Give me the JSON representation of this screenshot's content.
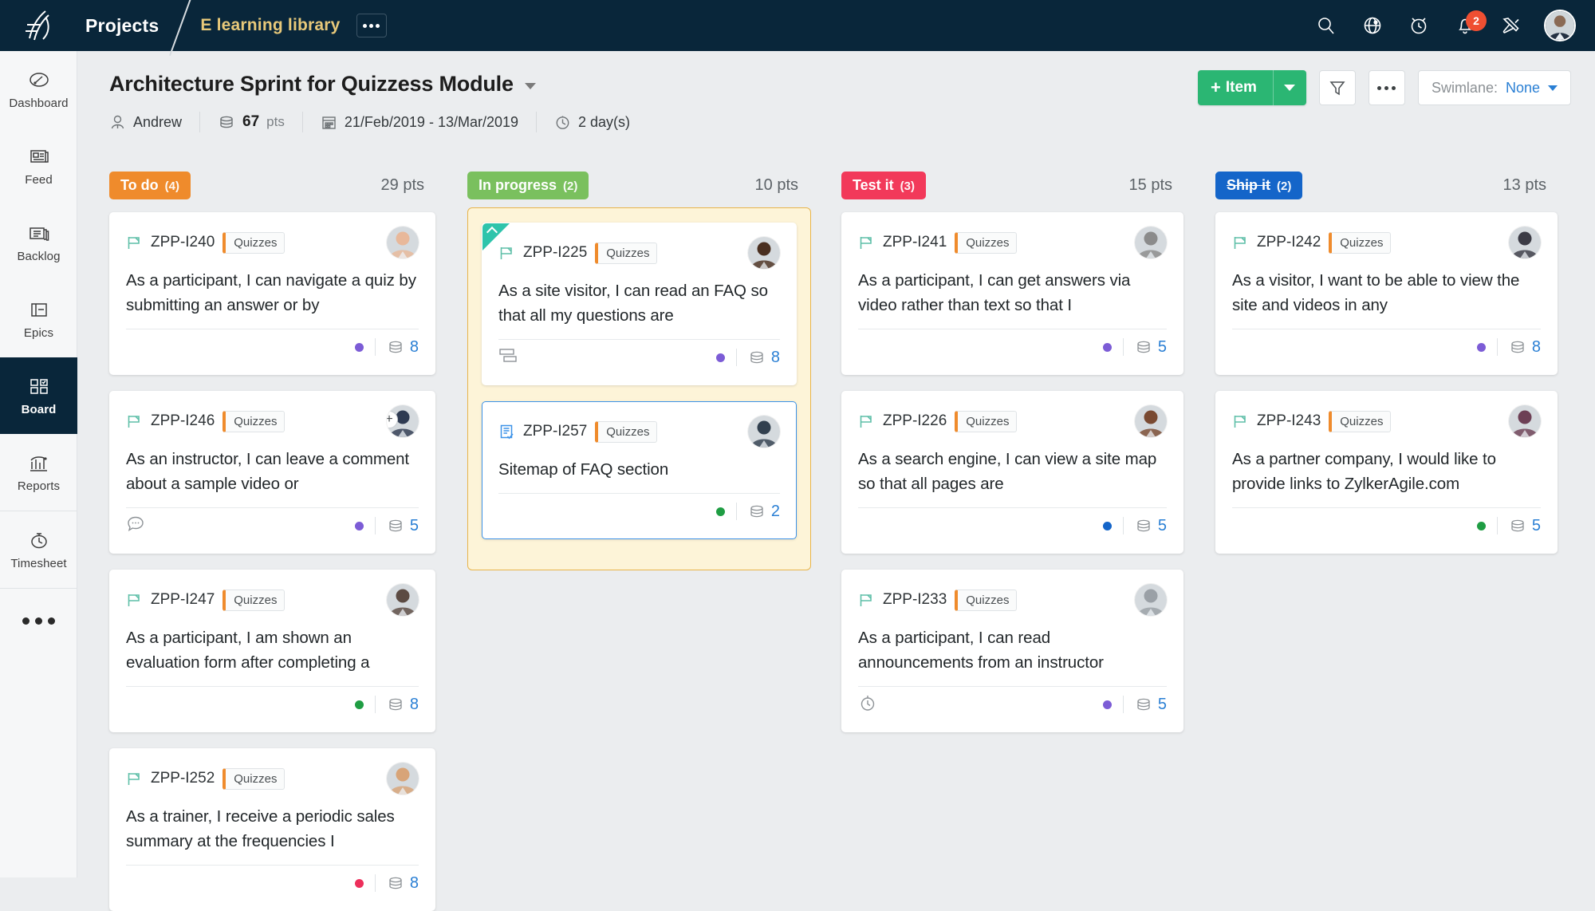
{
  "topbar": {
    "logo_icon": "zoho-sprints-logo-icon",
    "app_name": "Projects",
    "project_name": "E learning library",
    "project_more_label": "•••",
    "icons": [
      {
        "name": "search-icon",
        "label": "Search"
      },
      {
        "name": "globe-icon",
        "label": "Global"
      },
      {
        "name": "alarm-clock-icon",
        "label": "Timer"
      },
      {
        "name": "bell-icon",
        "label": "Notifications",
        "badge": "2"
      },
      {
        "name": "tools-icon",
        "label": "Setup"
      }
    ],
    "avatar_name": "user-avatar"
  },
  "sidebar": {
    "items": [
      {
        "label": "Dashboard",
        "icon": "gauge-icon",
        "active": false
      },
      {
        "label": "Feed",
        "icon": "feed-icon",
        "active": false
      },
      {
        "label": "Backlog",
        "icon": "backlog-icon",
        "active": false
      },
      {
        "label": "Epics",
        "icon": "epics-icon",
        "active": false
      },
      {
        "label": "Board",
        "icon": "board-icon",
        "active": true
      },
      {
        "label": "Reports",
        "icon": "reports-icon",
        "active": false
      },
      {
        "label": "Timesheet",
        "icon": "stopwatch-icon",
        "active": false
      }
    ],
    "more_label": "More"
  },
  "page_header": {
    "title": "Architecture Sprint for Quizzess Module",
    "owner": "Andrew",
    "points_value": "67",
    "points_unit": "pts",
    "date_range": "21/Feb/2019 - 13/Mar/2019",
    "days_left": "2 day(s)",
    "add_item_label": "Item",
    "add_item_plus": "+",
    "filter_label": "Filter",
    "more_label": "More actions",
    "swimlane_label": "Swimlane:",
    "swimlane_value": "None"
  },
  "colors": {
    "todo": "#ef8b2c",
    "in_progress": "#7ac05e",
    "test_it": "#f2395a",
    "ship_it": "#1465c9",
    "accent_green": "#2bb673",
    "link_blue": "#2a7fd4",
    "ribbon_teal": "#2ec4ab",
    "highlight_bg": "#fdf4d8",
    "highlight_border": "#e8b44a"
  },
  "board": {
    "columns": [
      {
        "name": "To do",
        "count": "(4)",
        "points": "29 pts",
        "color": "#ef8b2c",
        "strike": false,
        "highlight": false,
        "cards": [
          {
            "id": "ZPP-I240",
            "tag": "Quizzes",
            "title": "As a participant, I can navigate a quiz by submitting an answer or by",
            "type_icon": "flag-icon",
            "priority_color": "#7c5cd6",
            "points": "8",
            "footer_icon": "",
            "selected": false,
            "ribbon": false,
            "avatar_plus": false,
            "avatar_tone": "#e8b89a"
          },
          {
            "id": "ZPP-I246",
            "tag": "Quizzes",
            "title": "As an instructor, I can leave a comment about a sample video or",
            "type_icon": "flag-icon",
            "priority_color": "#7c5cd6",
            "points": "5",
            "footer_icon": "comment-icon",
            "selected": false,
            "ribbon": false,
            "avatar_plus": true,
            "avatar_tone": "#2f3b52"
          },
          {
            "id": "ZPP-I247",
            "tag": "Quizzes",
            "title": "As a participant, I am shown an evaluation form after completing a",
            "type_icon": "flag-icon",
            "priority_color": "#1f9d43",
            "points": "8",
            "footer_icon": "",
            "selected": false,
            "ribbon": false,
            "avatar_plus": false,
            "avatar_tone": "#5c4b43"
          },
          {
            "id": "ZPP-I252",
            "tag": "Quizzes",
            "title": "As a trainer, I receive a periodic sales summary at the frequencies I",
            "type_icon": "flag-icon",
            "priority_color": "#ed2f5b",
            "points": "8",
            "footer_icon": "",
            "selected": false,
            "ribbon": false,
            "avatar_plus": false,
            "avatar_tone": "#d8a478"
          }
        ]
      },
      {
        "name": "In progress",
        "count": "(2)",
        "points": "10 pts",
        "color": "#7ac05e",
        "strike": false,
        "highlight": true,
        "cards": [
          {
            "id": "ZPP-I225",
            "tag": "Quizzes",
            "title": "As a site visitor, I can read an FAQ so that all my questions are",
            "type_icon": "flag-icon",
            "priority_color": "#7c5cd6",
            "points": "8",
            "footer_icon": "subtask-icon",
            "selected": false,
            "ribbon": true,
            "avatar_plus": false,
            "avatar_tone": "#4a2f20"
          },
          {
            "id": "ZPP-I257",
            "tag": "Quizzes",
            "title": "Sitemap of FAQ section",
            "type_icon": "task-icon",
            "priority_color": "#1f9d43",
            "points": "2",
            "footer_icon": "",
            "selected": true,
            "ribbon": false,
            "avatar_plus": false,
            "avatar_tone": "#32404f"
          }
        ]
      },
      {
        "name": "Test it",
        "count": "(3)",
        "points": "15 pts",
        "color": "#f2395a",
        "strike": false,
        "highlight": false,
        "cards": [
          {
            "id": "ZPP-I241",
            "tag": "Quizzes",
            "title": "As a participant, I can get answers via video rather than text so that I",
            "type_icon": "flag-icon",
            "priority_color": "#7c5cd6",
            "points": "5",
            "footer_icon": "",
            "selected": false,
            "ribbon": false,
            "avatar_plus": false,
            "avatar_tone": "#8b8b8b"
          },
          {
            "id": "ZPP-I226",
            "tag": "Quizzes",
            "title": "As a search engine, I can view a site map so that all pages are",
            "type_icon": "flag-icon",
            "priority_color": "#1465c9",
            "points": "5",
            "footer_icon": "",
            "selected": false,
            "ribbon": false,
            "avatar_plus": false,
            "avatar_tone": "#7a4a32"
          },
          {
            "id": "ZPP-I233",
            "tag": "Quizzes",
            "title": "As a participant, I can read announcements from an instructor",
            "type_icon": "flag-icon",
            "priority_color": "#7c5cd6",
            "points": "5",
            "footer_icon": "timer-icon",
            "selected": false,
            "ribbon": false,
            "avatar_plus": false,
            "avatar_tone": "#9aa0a6"
          }
        ]
      },
      {
        "name": "Ship it",
        "count": "(2)",
        "points": "13 pts",
        "color": "#1465c9",
        "strike": true,
        "highlight": false,
        "cards": [
          {
            "id": "ZPP-I242",
            "tag": "Quizzes",
            "title": "As a visitor, I want to be able to view the site and videos in any",
            "type_icon": "flag-icon",
            "priority_color": "#7c5cd6",
            "points": "8",
            "footer_icon": "",
            "selected": false,
            "ribbon": false,
            "avatar_plus": false,
            "avatar_tone": "#3b3b45"
          },
          {
            "id": "ZPP-I243",
            "tag": "Quizzes",
            "title": "As a partner company, I would like to provide links to ZylkerAgile.com",
            "type_icon": "flag-icon",
            "priority_color": "#1f9d43",
            "points": "5",
            "footer_icon": "",
            "selected": false,
            "ribbon": false,
            "avatar_plus": false,
            "avatar_tone": "#6d3f55"
          }
        ]
      }
    ]
  }
}
